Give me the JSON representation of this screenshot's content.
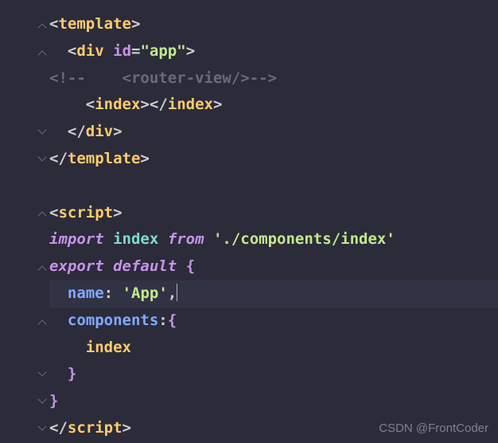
{
  "watermark": "CSDN @FrontCoder",
  "tokens": {
    "lt": "<",
    "gt": ">",
    "lts": "</",
    "eq": "=",
    "sq": "'",
    "dq": "\"",
    "lbrace": "{",
    "rbrace": "}",
    "comma": ",",
    "colon": ":",
    "template": "template",
    "div": "div",
    "id": "id",
    "app": "app",
    "comment_open": "<!--",
    "comment_router": "    <router-view/>",
    "comment_close": "-->",
    "index": "index",
    "script": "script",
    "import": "import",
    "from": "from",
    "path": "./components/index",
    "export": "export",
    "default": "default",
    "name": "name",
    "app_str": "App",
    "components": "components"
  }
}
